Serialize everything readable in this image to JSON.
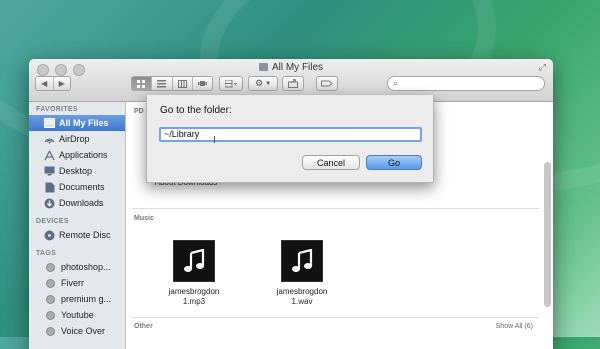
{
  "window": {
    "title": "All My Files"
  },
  "toolbar": {
    "back": "◀",
    "forward": "▶",
    "action_icon": "gear-icon",
    "share_icon": "share-icon",
    "tag_icon": "tag-icon",
    "search_placeholder": ""
  },
  "sidebar": {
    "favorites_header": "FAVORITES",
    "favorites": [
      {
        "label": "All My Files",
        "icon": "all-files-icon",
        "selected": true
      },
      {
        "label": "AirDrop",
        "icon": "airdrop-icon"
      },
      {
        "label": "Applications",
        "icon": "applications-icon"
      },
      {
        "label": "Desktop",
        "icon": "desktop-icon"
      },
      {
        "label": "Documents",
        "icon": "documents-icon"
      },
      {
        "label": "Downloads",
        "icon": "downloads-icon"
      }
    ],
    "devices_header": "DEVICES",
    "devices": [
      {
        "label": "Remote Disc",
        "icon": "disc-icon"
      }
    ],
    "tags_header": "TAGS",
    "tags": [
      {
        "label": "photoshop..."
      },
      {
        "label": "Fiverr"
      },
      {
        "label": "premium g..."
      },
      {
        "label": "Youtube"
      },
      {
        "label": "Voice Over"
      }
    ]
  },
  "main": {
    "partial_section_header": "PD",
    "partial_file_label": "About Downloads",
    "music": {
      "header": "Music",
      "files": [
        {
          "line1": "jamesbrogdon",
          "line2": "1.mp3"
        },
        {
          "line1": "jamesbrogdon",
          "line2": "1.wav"
        }
      ]
    },
    "other": {
      "header": "Other",
      "show_all": "Show All (6)"
    }
  },
  "dialog": {
    "label": "Go to the folder:",
    "value": "~/Library",
    "cancel": "Cancel",
    "go": "Go"
  },
  "colors": {
    "selection": "#3f78cf",
    "go_button": "#5999ec",
    "input_focus": "#74a3e6"
  }
}
